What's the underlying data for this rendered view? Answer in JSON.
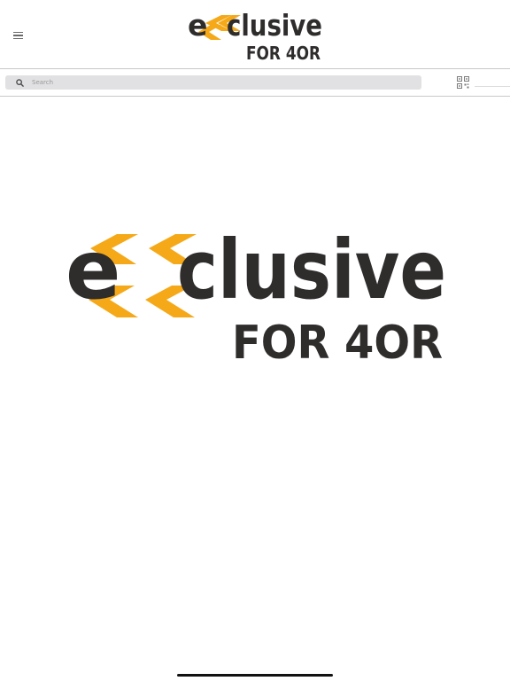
{
  "header": {
    "menu_icon": "hamburger-menu-icon",
    "logo": {
      "word": "exclusive",
      "word_tail": "clusive",
      "letter_e": "e",
      "subline": "FOR 4OR"
    }
  },
  "search": {
    "placeholder": "Search",
    "value": "",
    "icon": "search-icon",
    "scan_icon": "qr-code-icon"
  },
  "hero": {
    "logo": {
      "word": "exclusive",
      "word_tail": "clusive",
      "letter_e": "e",
      "subline": "FOR 4OR"
    }
  },
  "colors": {
    "brand_orange": "#f5a918",
    "brand_text": "#2f2c2c",
    "search_bg": "#e1e1e3",
    "divider": "#c9c9c9"
  }
}
